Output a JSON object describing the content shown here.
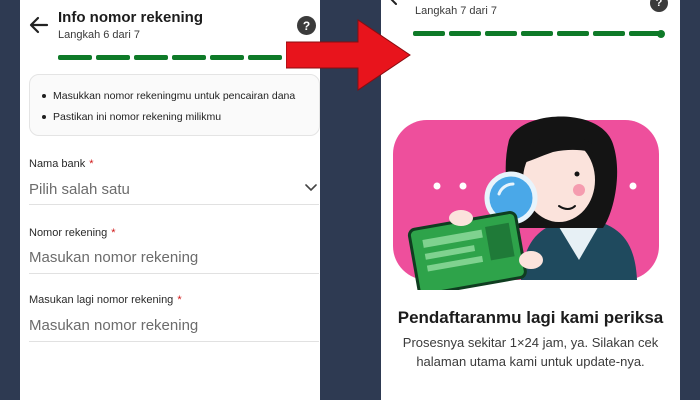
{
  "left_screen": {
    "header": {
      "title": "Info nomor rekening",
      "step": "Langkah 6 dari 7",
      "help_label": "?",
      "progress": {
        "total_steps": 7,
        "completed_steps": 6
      }
    },
    "info": {
      "items": [
        "Masukkan nomor rekeningmu untuk pencairan dana",
        "Pastikan ini nomor rekening milikmu"
      ]
    },
    "fields": [
      {
        "label": "Nama bank",
        "required_mark": "*",
        "value": "Pilih salah satu"
      },
      {
        "label": "Nomor rekening",
        "required_mark": "*",
        "value": "Masukan nomor rekening"
      },
      {
        "label": "Masukan lagi nomor rekening",
        "required_mark": "*",
        "value": "Masukan nomor rekening"
      }
    ]
  },
  "right_screen": {
    "header": {
      "step": "Langkah 7 dari 7",
      "help_label": "?",
      "progress": {
        "total_steps": 7,
        "completed_steps": 7
      }
    },
    "message": {
      "title": "Pendaftaranmu lagi kami periksa",
      "body": "Prosesnya sekitar 1×24 jam, ya. Silakan cek halaman utama kami untuk update-nya."
    }
  },
  "colors": {
    "background": "#2e3a52",
    "accent_green": "#0e7a28",
    "arrow_red": "#e8141c",
    "illustration_pink": "#ee4f9c",
    "required_red": "#d01818"
  },
  "icons": [
    "back-arrow-icon",
    "help-icon",
    "chevron-down-icon",
    "red-arrow-icon",
    "magnifier-icon"
  ]
}
